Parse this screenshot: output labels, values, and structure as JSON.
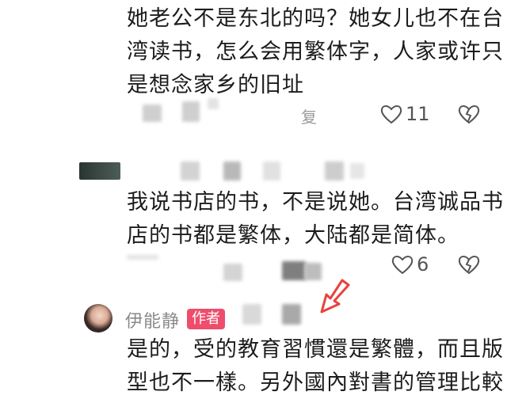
{
  "comments": [
    {
      "lines": [
        "她老公不是东北的吗？她女儿也不在台",
        "湾读书，怎么会用繁体字，人家或许只",
        "是想念家乡的旧址"
      ],
      "meta_fragment": "复",
      "likes": "11"
    },
    {
      "lines": [
        "我说书店的书，不是说她。台湾诚品书",
        "店的书都是繁体，大陆都是简体。"
      ],
      "likes": "6"
    },
    {
      "author_name": "伊能静",
      "badge": "作者",
      "lines": [
        "是的，受的教育習慣還是繁體，而且版",
        "型也不一樣。另外國內對書的管理比較"
      ]
    }
  ],
  "colors": {
    "badge_bg": "#ee4d6b",
    "arrow": "#e8433c",
    "icon_stroke": "#555555"
  },
  "icons": [
    "heart-outline-icon",
    "broken-heart-icon",
    "arrow-pointer-icon"
  ]
}
